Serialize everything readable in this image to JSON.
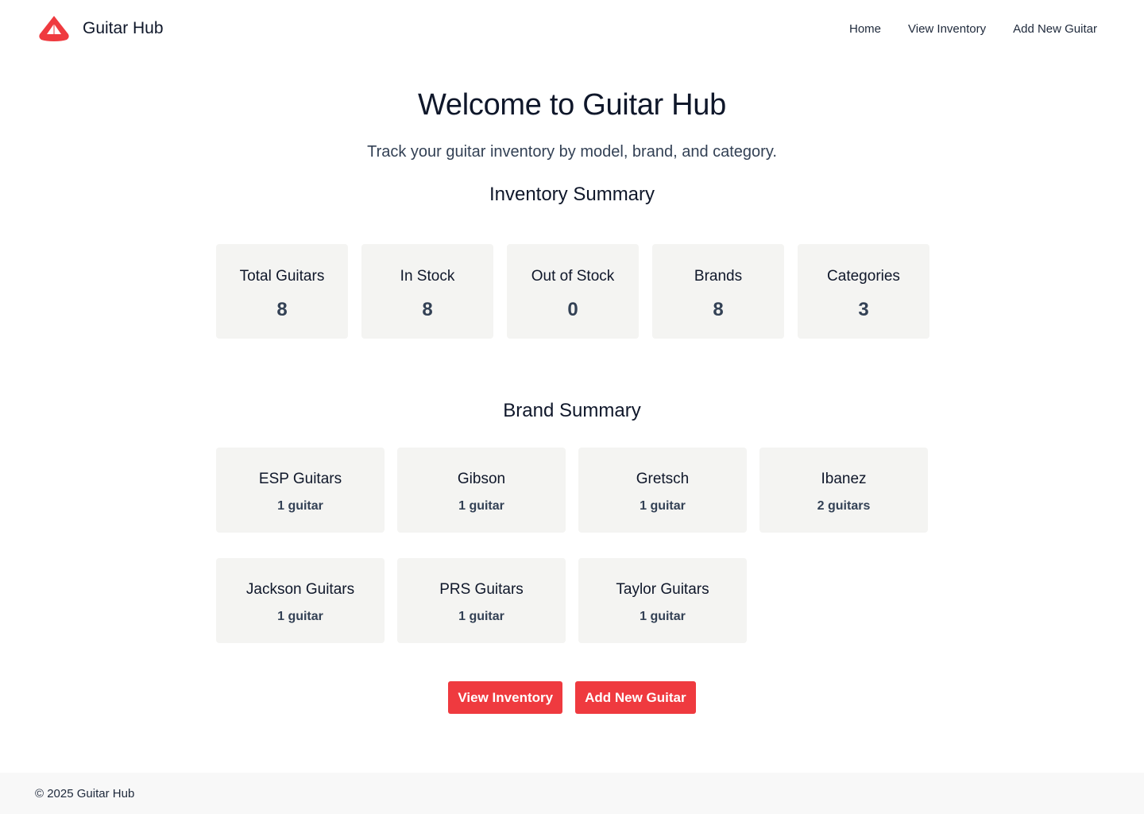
{
  "header": {
    "brand_name": "Guitar Hub",
    "logo": "guitar-hub-logo",
    "nav": [
      {
        "label": "Home"
      },
      {
        "label": "View Inventory"
      },
      {
        "label": "Add New Guitar"
      }
    ]
  },
  "main": {
    "title": "Welcome to Guitar Hub",
    "subtitle": "Track your guitar inventory by model, brand, and category.",
    "inventory_summary": {
      "title": "Inventory Summary",
      "stats": [
        {
          "label": "Total Guitars",
          "value": "8"
        },
        {
          "label": "In Stock",
          "value": "8"
        },
        {
          "label": "Out of Stock",
          "value": "0"
        },
        {
          "label": "Brands",
          "value": "8"
        },
        {
          "label": "Categories",
          "value": "3"
        }
      ]
    },
    "brand_summary": {
      "title": "Brand Summary",
      "brands": [
        {
          "name": "ESP Guitars",
          "count": "1 guitar"
        },
        {
          "name": "Gibson",
          "count": "1 guitar"
        },
        {
          "name": "Gretsch",
          "count": "1 guitar"
        },
        {
          "name": "Ibanez",
          "count": "2 guitars"
        },
        {
          "name": "Jackson Guitars",
          "count": "1 guitar"
        },
        {
          "name": "PRS Guitars",
          "count": "1 guitar"
        },
        {
          "name": "Taylor Guitars",
          "count": "1 guitar"
        }
      ]
    },
    "actions": {
      "view_inventory_label": "View Inventory",
      "add_guitar_label": "Add New Guitar"
    }
  },
  "footer": {
    "text": "© 2025 Guitar Hub"
  },
  "colors": {
    "accent": "#ef3a3f",
    "card_bg": "#f4f4f2",
    "footer_bg": "#f8f8f8",
    "heading": "#0f172a",
    "muted": "#334155"
  }
}
